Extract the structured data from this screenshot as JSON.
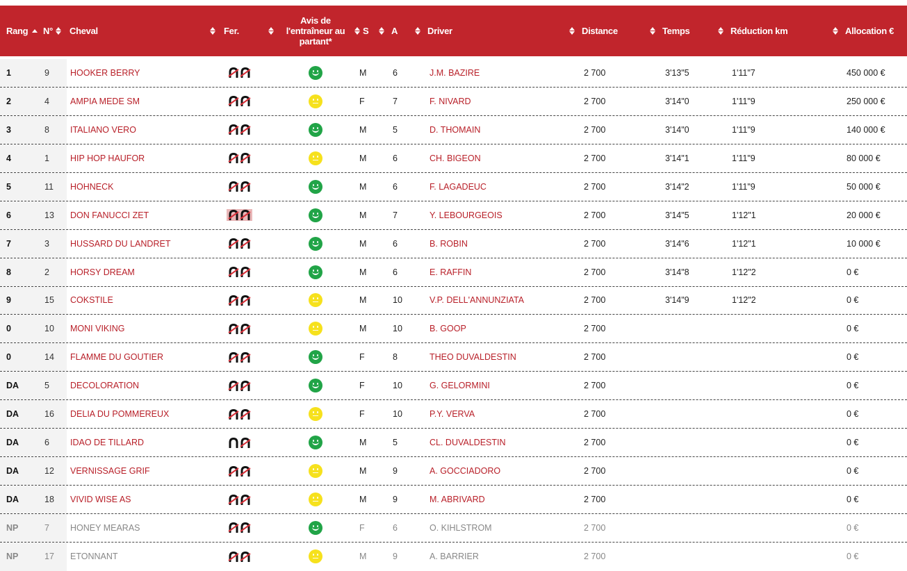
{
  "table": {
    "headers": {
      "rang": "Rang",
      "num": "N°",
      "cheval": "Cheval",
      "fer": "Fer.",
      "avis": "Avis de l'entraîneur au partant*",
      "s": "S",
      "a": "A",
      "driver": "Driver",
      "distance": "Distance",
      "temps": "Temps",
      "reduction": "Réduction km",
      "allocation": "Allocation €"
    },
    "colors": {
      "header_bg": "#c1252c",
      "link": "#b81f28",
      "happy": "#21a447",
      "neutral": "#f6e11d"
    },
    "rows": [
      {
        "rang": "1",
        "num": "9",
        "cheval": "HOOKER BERRY",
        "fer": "both-crossed",
        "avis": "happy",
        "s": "M",
        "a": "6",
        "driver": "J.M. BAZIRE",
        "distance": "2 700",
        "temps": "3'13\"5",
        "reduction": "1'11\"7",
        "allocation": "450 000 €"
      },
      {
        "rang": "2",
        "num": "4",
        "cheval": "AMPIA MEDE SM",
        "fer": "both-crossed",
        "avis": "neutral",
        "s": "F",
        "a": "7",
        "driver": "F. NIVARD",
        "distance": "2 700",
        "temps": "3'14\"0",
        "reduction": "1'11\"9",
        "allocation": "250 000 €"
      },
      {
        "rang": "3",
        "num": "8",
        "cheval": "ITALIANO VERO",
        "fer": "both-crossed",
        "avis": "happy",
        "s": "M",
        "a": "5",
        "driver": "D. THOMAIN",
        "distance": "2 700",
        "temps": "3'14\"0",
        "reduction": "1'11\"9",
        "allocation": "140 000 €"
      },
      {
        "rang": "4",
        "num": "1",
        "cheval": "HIP HOP HAUFOR",
        "fer": "both-crossed",
        "avis": "neutral",
        "s": "M",
        "a": "6",
        "driver": "CH. BIGEON",
        "distance": "2 700",
        "temps": "3'14\"1",
        "reduction": "1'11\"9",
        "allocation": "80 000 €"
      },
      {
        "rang": "5",
        "num": "11",
        "cheval": "HOHNECK",
        "fer": "both-crossed",
        "avis": "happy",
        "s": "M",
        "a": "6",
        "driver": "F. LAGADEUC",
        "distance": "2 700",
        "temps": "3'14\"2",
        "reduction": "1'11\"9",
        "allocation": "50 000 €"
      },
      {
        "rang": "6",
        "num": "13",
        "cheval": "DON FANUCCI ZET",
        "fer": "both-crossed-highlight",
        "avis": "happy",
        "s": "M",
        "a": "7",
        "driver": "Y. LEBOURGEOIS",
        "distance": "2 700",
        "temps": "3'14\"5",
        "reduction": "1'12\"1",
        "allocation": "20 000 €"
      },
      {
        "rang": "7",
        "num": "3",
        "cheval": "HUSSARD DU LANDRET",
        "fer": "both-crossed",
        "avis": "happy",
        "s": "M",
        "a": "6",
        "driver": "B. ROBIN",
        "distance": "2 700",
        "temps": "3'14\"6",
        "reduction": "1'12\"1",
        "allocation": "10 000 €"
      },
      {
        "rang": "8",
        "num": "2",
        "cheval": "HORSY DREAM",
        "fer": "both-crossed",
        "avis": "happy",
        "s": "M",
        "a": "6",
        "driver": "E. RAFFIN",
        "distance": "2 700",
        "temps": "3'14\"8",
        "reduction": "1'12\"2",
        "allocation": "0 €"
      },
      {
        "rang": "9",
        "num": "15",
        "cheval": "COKSTILE",
        "fer": "both-crossed",
        "avis": "neutral",
        "s": "M",
        "a": "10",
        "driver": "V.P. DELL'ANNUNZIATA",
        "distance": "2 700",
        "temps": "3'14\"9",
        "reduction": "1'12\"2",
        "allocation": "0 €"
      },
      {
        "rang": "0",
        "num": "10",
        "cheval": "MONI VIKING",
        "fer": "both-crossed",
        "avis": "neutral",
        "s": "M",
        "a": "10",
        "driver": "B. GOOP",
        "distance": "2 700",
        "temps": "",
        "reduction": "",
        "allocation": "0 €"
      },
      {
        "rang": "0",
        "num": "14",
        "cheval": "FLAMME DU GOUTIER",
        "fer": "both-crossed",
        "avis": "happy",
        "s": "F",
        "a": "8",
        "driver": "THEO DUVALDESTIN",
        "distance": "2 700",
        "temps": "",
        "reduction": "",
        "allocation": "0 €"
      },
      {
        "rang": "DA",
        "num": "5",
        "cheval": "DECOLORATION",
        "fer": "both-crossed",
        "avis": "happy",
        "s": "F",
        "a": "10",
        "driver": "G. GELORMINI",
        "distance": "2 700",
        "temps": "",
        "reduction": "",
        "allocation": "0 €"
      },
      {
        "rang": "DA",
        "num": "16",
        "cheval": "DELIA DU POMMEREUX",
        "fer": "both-crossed",
        "avis": "neutral",
        "s": "F",
        "a": "10",
        "driver": "P.Y. VERVA",
        "distance": "2 700",
        "temps": "",
        "reduction": "",
        "allocation": "0 €"
      },
      {
        "rang": "DA",
        "num": "6",
        "cheval": "IDAO DE TILLARD",
        "fer": "rear-crossed",
        "avis": "happy",
        "s": "M",
        "a": "5",
        "driver": "CL. DUVALDESTIN",
        "distance": "2 700",
        "temps": "",
        "reduction": "",
        "allocation": "0 €"
      },
      {
        "rang": "DA",
        "num": "12",
        "cheval": "VERNISSAGE GRIF",
        "fer": "both-crossed",
        "avis": "neutral",
        "s": "M",
        "a": "9",
        "driver": "A. GOCCIADORO",
        "distance": "2 700",
        "temps": "",
        "reduction": "",
        "allocation": "0 €"
      },
      {
        "rang": "DA",
        "num": "18",
        "cheval": "VIVID WISE AS",
        "fer": "both-crossed",
        "avis": "neutral",
        "s": "M",
        "a": "9",
        "driver": "M. ABRIVARD",
        "distance": "2 700",
        "temps": "",
        "reduction": "",
        "allocation": "0 €"
      },
      {
        "rang": "NP",
        "num": "7",
        "cheval": "HONEY MEARAS",
        "fer": "both-crossed",
        "avis": "happy",
        "s": "F",
        "a": "6",
        "driver": "O. KIHLSTROM",
        "distance": "2 700",
        "temps": "",
        "reduction": "",
        "allocation": "0 €"
      },
      {
        "rang": "NP",
        "num": "17",
        "cheval": "ETONNANT",
        "fer": "both-crossed",
        "avis": "neutral",
        "s": "M",
        "a": "9",
        "driver": "A. BARRIER",
        "distance": "2 700",
        "temps": "",
        "reduction": "",
        "allocation": "0 €"
      }
    ]
  }
}
